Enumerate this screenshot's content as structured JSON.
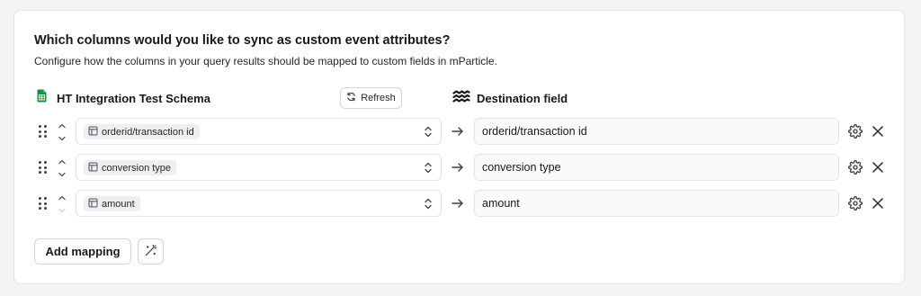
{
  "section": {
    "title": "Which columns would you like to sync as custom event attributes?",
    "subtitle": "Configure how the columns in your query results should be mapped to custom fields in mParticle."
  },
  "source": {
    "icon": "google-sheets-icon",
    "label": "HT Integration Test Schema",
    "refresh_label": "Refresh"
  },
  "destination": {
    "icon": "mparticle-logo-icon",
    "label": "Destination field"
  },
  "mappings": [
    {
      "source_column": "orderid/transaction id",
      "destination_field": "orderid/transaction id",
      "can_move_up": true,
      "can_move_down": true
    },
    {
      "source_column": "conversion type",
      "destination_field": "conversion type",
      "can_move_up": true,
      "can_move_down": true
    },
    {
      "source_column": "amount",
      "destination_field": "amount",
      "can_move_up": true,
      "can_move_down": false
    }
  ],
  "actions": {
    "add_mapping_label": "Add mapping",
    "magic_icon": "magic-wand-icon"
  },
  "colors": {
    "sheets_green": "#1e8e3e",
    "border": "#e4e4e7",
    "chip_bg": "#efeff1",
    "text": "#18181b",
    "muted_icon": "#52525b",
    "disabled_arrow": "#d4d4d8"
  }
}
